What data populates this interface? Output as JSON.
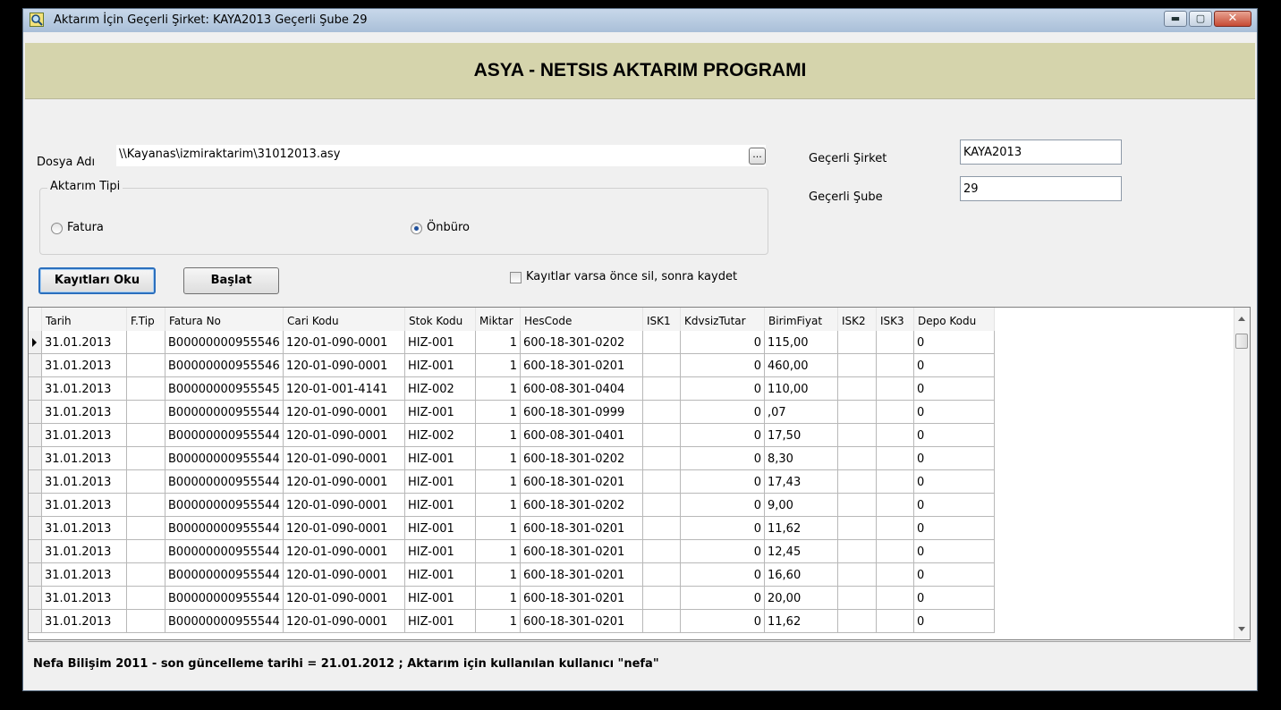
{
  "window": {
    "title": "Aktarım İçin Geçerli Şirket: KAYA2013 Geçerli Şube 29",
    "min_glyph": "▬",
    "max_glyph": "▢",
    "close_glyph": "✕"
  },
  "banner": {
    "title": "ASYA - NETSIS AKTARIM PROGRAMI"
  },
  "form": {
    "dosya_label": "Dosya Adı",
    "dosya_value": "\\\\Kayanas\\izmiraktarim\\31012013.asy",
    "browse_label": "...",
    "sirket_label": "Geçerli Şirket",
    "sirket_value": "KAYA2013",
    "sube_label": "Geçerli Şube",
    "sube_value": "29",
    "aktarim_tipi_label": "Aktarım Tipi",
    "radio_fatura": "Fatura",
    "radio_onburo": "Önbüro",
    "selected": "Önbüro",
    "btn_oku": "Kayıtları Oku",
    "btn_baslat": "Başlat",
    "checkbox_label": "Kayıtlar varsa önce sil, sonra kaydet",
    "checkbox_checked": false
  },
  "grid": {
    "headers": [
      "Tarih",
      "F.Tip",
      "Fatura No",
      "Cari Kodu",
      "Stok Kodu",
      "Miktar",
      "HesCode",
      "ISK1",
      "KdvsizTutar",
      "BirimFiyat",
      "ISK2",
      "ISK3",
      "Depo Kodu"
    ],
    "rows": [
      [
        "31.01.2013",
        "",
        "B00000000955546",
        "120-01-090-0001",
        "HIZ-001",
        "1",
        "600-18-301-0202",
        "",
        "0",
        "115,00",
        "",
        "",
        "0"
      ],
      [
        "31.01.2013",
        "",
        "B00000000955546",
        "120-01-090-0001",
        "HIZ-001",
        "1",
        "600-18-301-0201",
        "",
        "0",
        "460,00",
        "",
        "",
        "0"
      ],
      [
        "31.01.2013",
        "",
        "B00000000955545",
        "120-01-001-4141",
        "HIZ-002",
        "1",
        "600-08-301-0404",
        "",
        "0",
        "110,00",
        "",
        "",
        "0"
      ],
      [
        "31.01.2013",
        "",
        "B00000000955544",
        "120-01-090-0001",
        "HIZ-001",
        "1",
        "600-18-301-0999",
        "",
        "0",
        ",07",
        "",
        "",
        "0"
      ],
      [
        "31.01.2013",
        "",
        "B00000000955544",
        "120-01-090-0001",
        "HIZ-002",
        "1",
        "600-08-301-0401",
        "",
        "0",
        "17,50",
        "",
        "",
        "0"
      ],
      [
        "31.01.2013",
        "",
        "B00000000955544",
        "120-01-090-0001",
        "HIZ-001",
        "1",
        "600-18-301-0202",
        "",
        "0",
        "8,30",
        "",
        "",
        "0"
      ],
      [
        "31.01.2013",
        "",
        "B00000000955544",
        "120-01-090-0001",
        "HIZ-001",
        "1",
        "600-18-301-0201",
        "",
        "0",
        "17,43",
        "",
        "",
        "0"
      ],
      [
        "31.01.2013",
        "",
        "B00000000955544",
        "120-01-090-0001",
        "HIZ-001",
        "1",
        "600-18-301-0202",
        "",
        "0",
        "9,00",
        "",
        "",
        "0"
      ],
      [
        "31.01.2013",
        "",
        "B00000000955544",
        "120-01-090-0001",
        "HIZ-001",
        "1",
        "600-18-301-0201",
        "",
        "0",
        "11,62",
        "",
        "",
        "0"
      ],
      [
        "31.01.2013",
        "",
        "B00000000955544",
        "120-01-090-0001",
        "HIZ-001",
        "1",
        "600-18-301-0201",
        "",
        "0",
        "12,45",
        "",
        "",
        "0"
      ],
      [
        "31.01.2013",
        "",
        "B00000000955544",
        "120-01-090-0001",
        "HIZ-001",
        "1",
        "600-18-301-0201",
        "",
        "0",
        "16,60",
        "",
        "",
        "0"
      ],
      [
        "31.01.2013",
        "",
        "B00000000955544",
        "120-01-090-0001",
        "HIZ-001",
        "1",
        "600-18-301-0201",
        "",
        "0",
        "20,00",
        "",
        "",
        "0"
      ],
      [
        "31.01.2013",
        "",
        "B00000000955544",
        "120-01-090-0001",
        "HIZ-001",
        "1",
        "600-18-301-0201",
        "",
        "0",
        "11,62",
        "",
        "",
        "0"
      ]
    ]
  },
  "status": {
    "text": "Nefa Bilişim 2011 - son güncelleme tarihi = 21.01.2012 ; Aktarım için kullanılan kullanıcı \"nefa\""
  }
}
